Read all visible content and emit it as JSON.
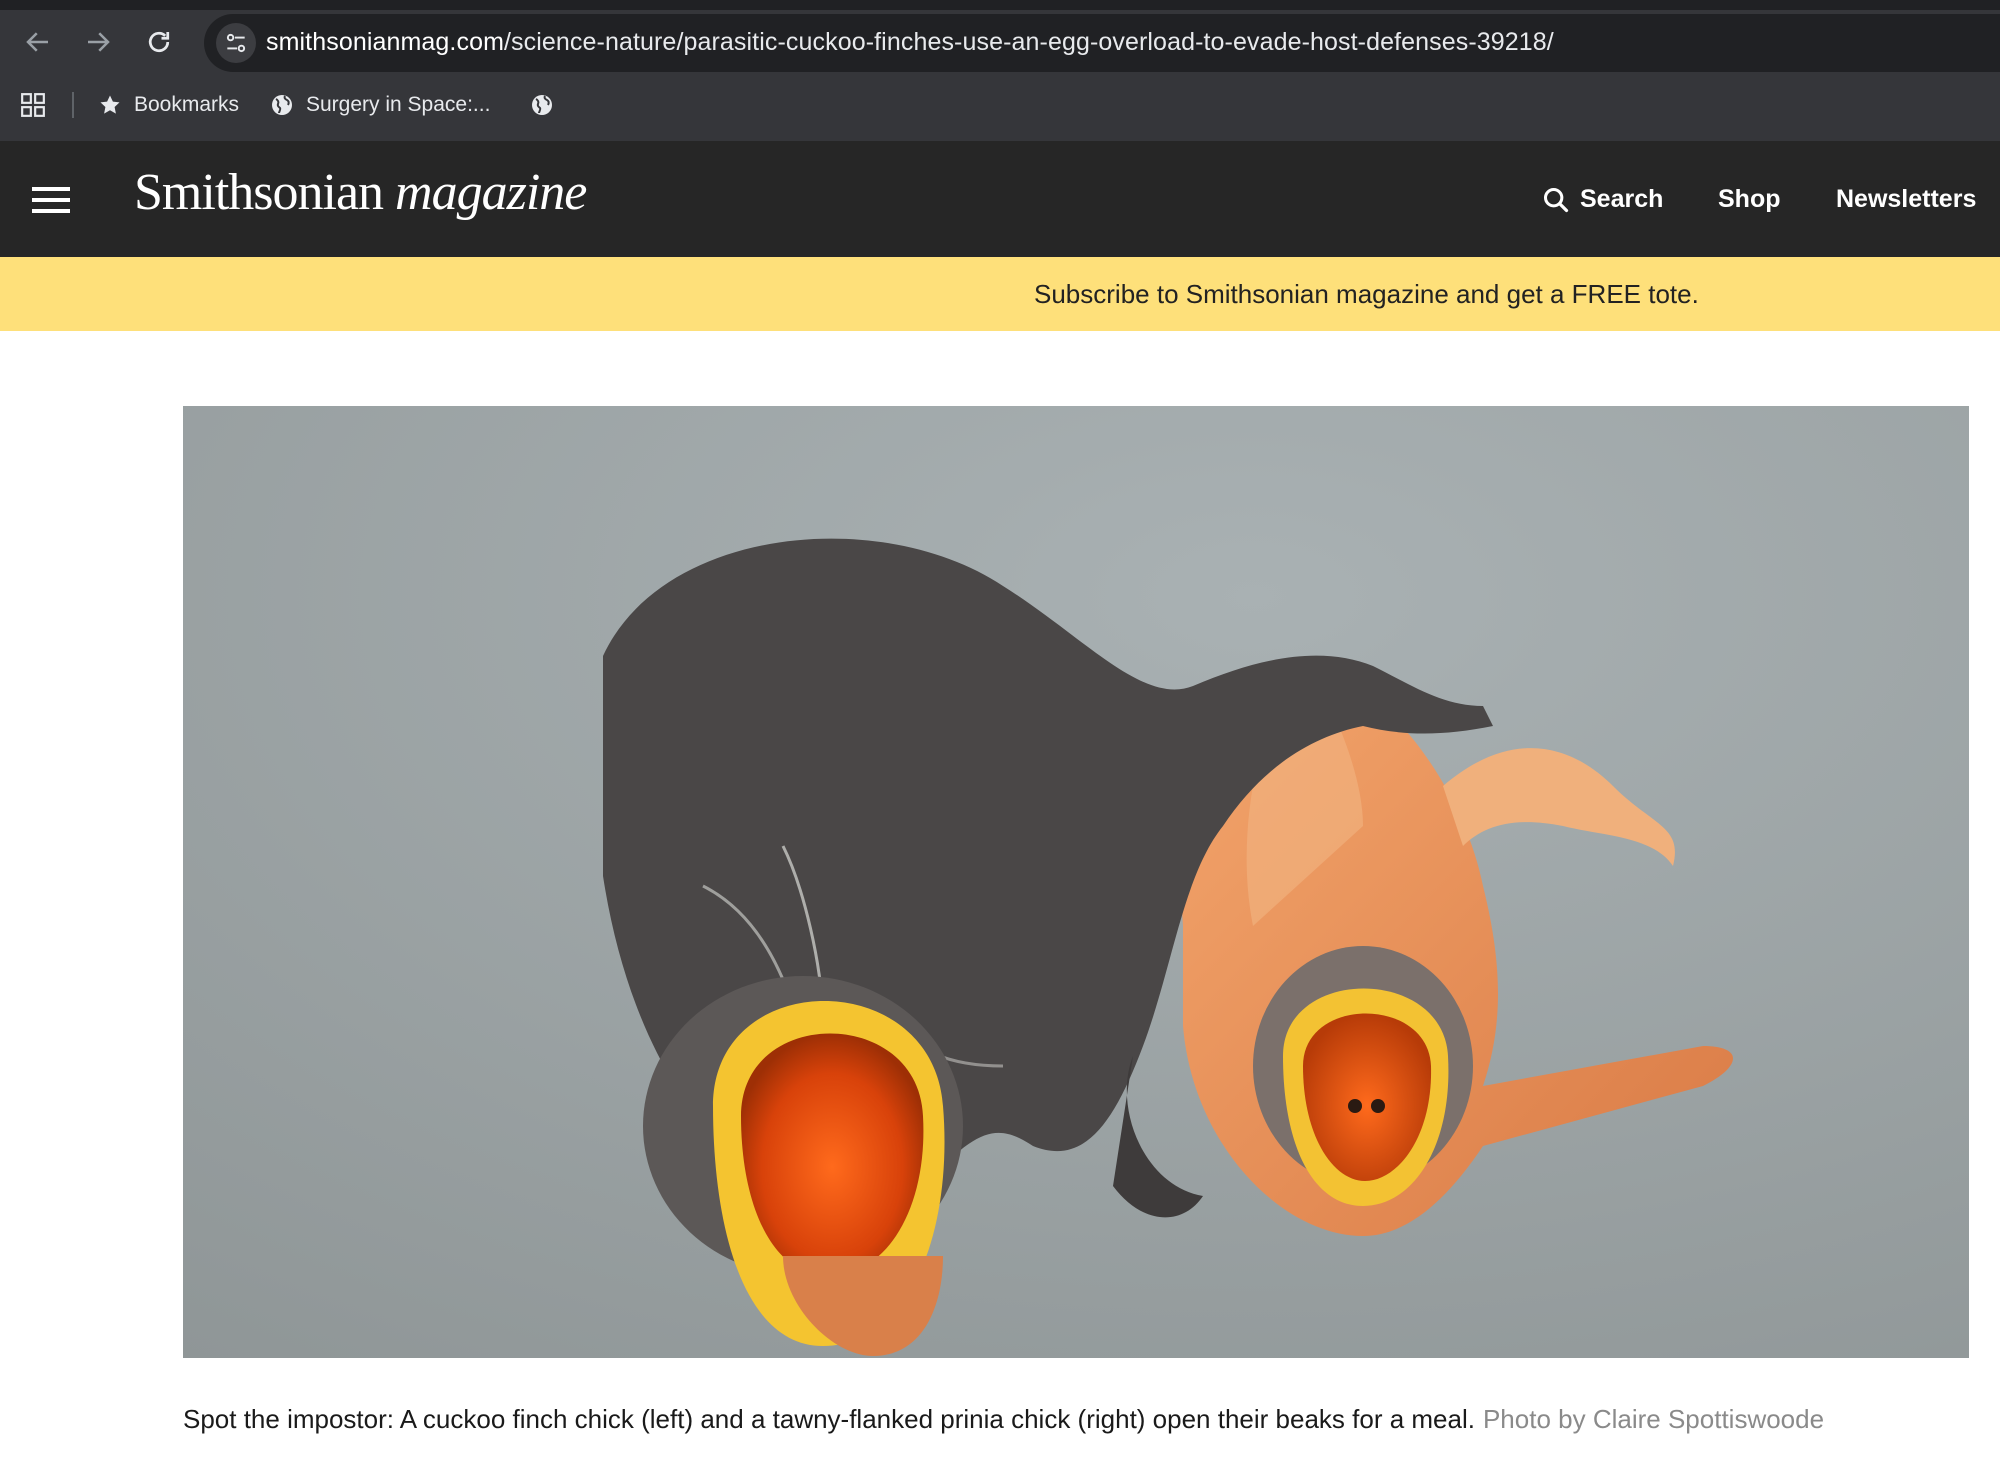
{
  "browser": {
    "url_host": "smithsonianmag.com",
    "url_path": "/science-nature/parasitic-cuckoo-finches-use-an-egg-overload-to-evade-host-defenses-39218/",
    "icons": [
      "back-arrow-icon",
      "forward-arrow-icon",
      "reload-icon",
      "site-info-icon",
      "apps-grid-icon",
      "star-icon",
      "globe-icon"
    ],
    "bookmarks": [
      {
        "label": "Bookmarks"
      },
      {
        "label": "Surgery in Space:..."
      },
      {
        "label": ""
      }
    ]
  },
  "site": {
    "logo_main": "Smithsonian",
    "logo_sub": "magazine",
    "nav": {
      "search": "Search",
      "shop": "Shop",
      "newsletters": "Newsletters"
    }
  },
  "promo": {
    "text": "Subscribe to Smithsonian magazine and get a FREE tote.",
    "background": "#fee07a"
  },
  "article": {
    "caption": "Spot the impostor: A cuckoo finch chick (left) and a tawny-flanked prinia chick (right) open their beaks for a meal.",
    "credit": "Photo by Claire Spottiswoode"
  },
  "colors": {
    "chrome_bg": "#35363a",
    "header_bg": "#262626",
    "caption_credit": "#8a8a8a"
  }
}
